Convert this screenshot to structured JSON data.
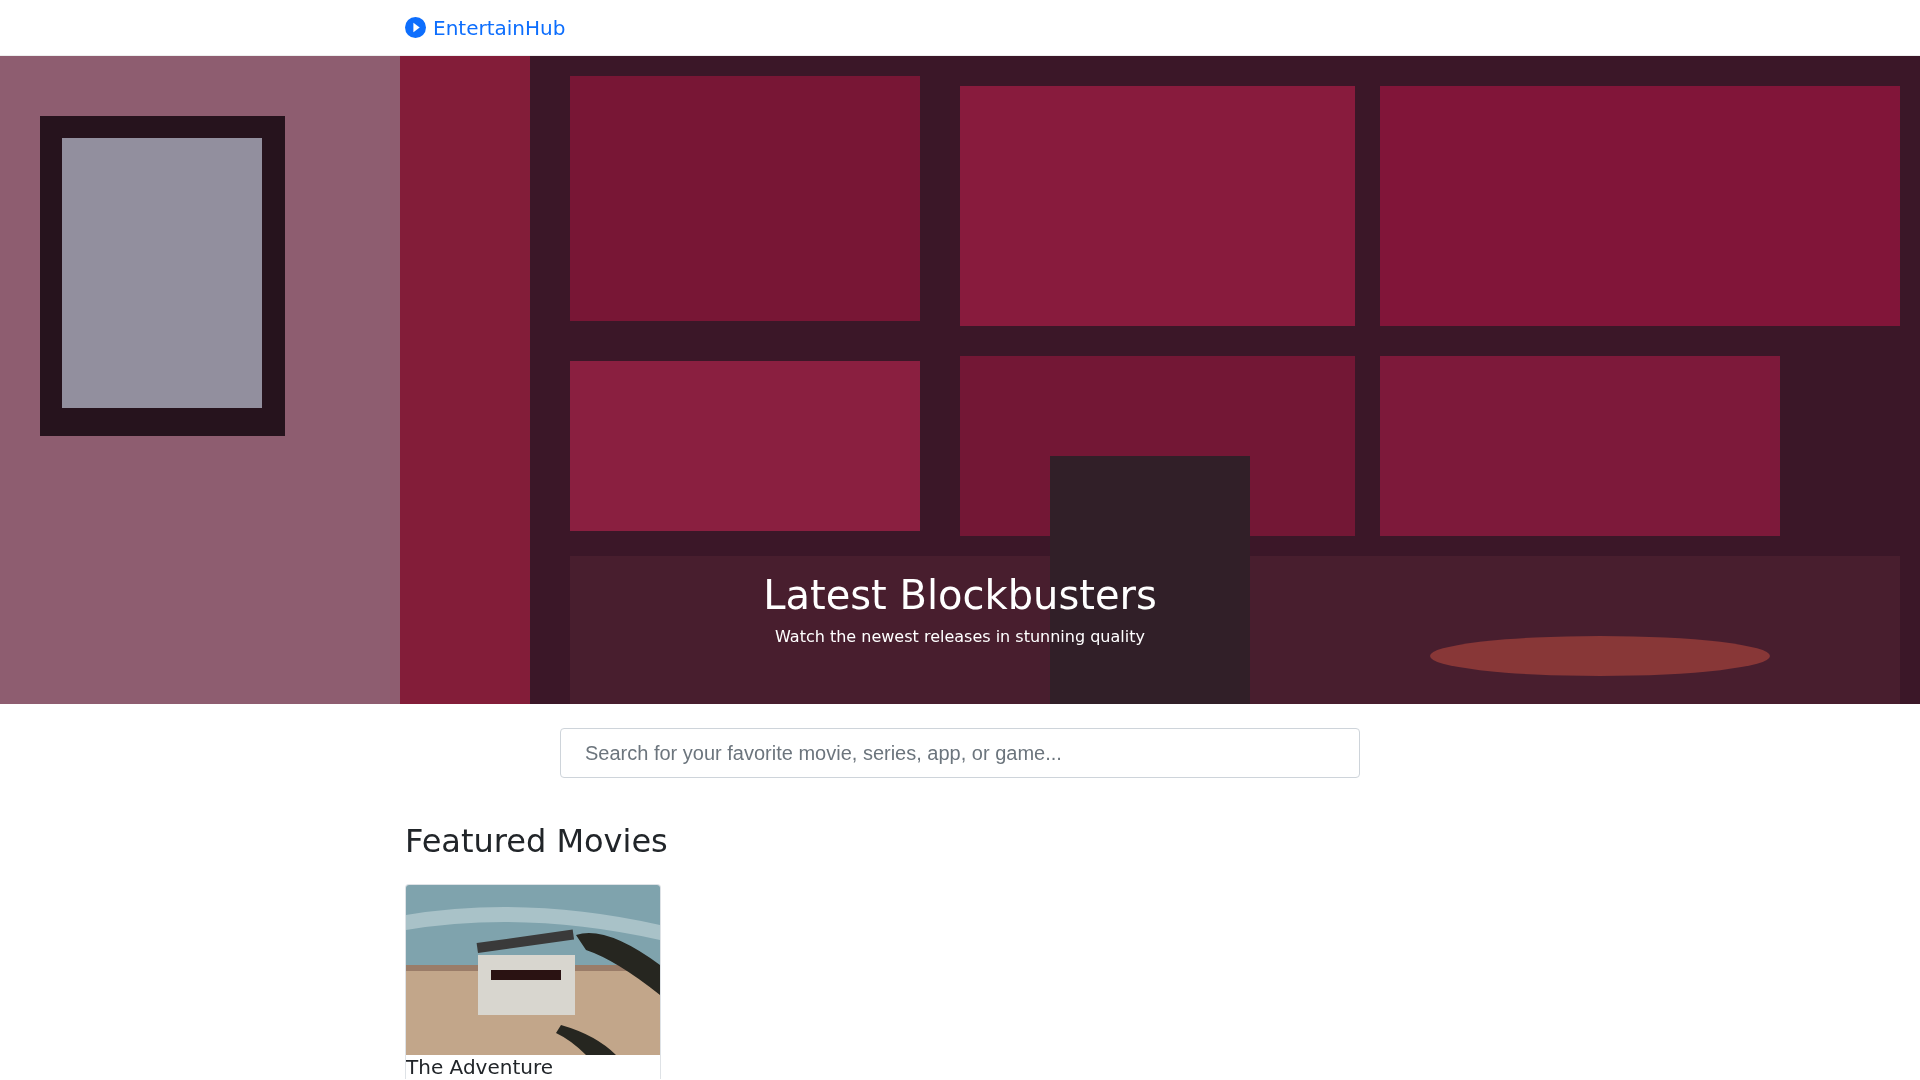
{
  "header": {
    "brand": "EntertainHub"
  },
  "hero": {
    "title": "Latest Blockbusters",
    "subtitle": "Watch the newest releases in stunning quality",
    "kind": "picture"
  },
  "search": {
    "placeholder": "Search for your favorite movie, series, app, or game..."
  },
  "featured": {
    "heading": "Featured Movies",
    "movies": [
      {
        "title": "The Adventure",
        "kind": "picture"
      }
    ]
  }
}
